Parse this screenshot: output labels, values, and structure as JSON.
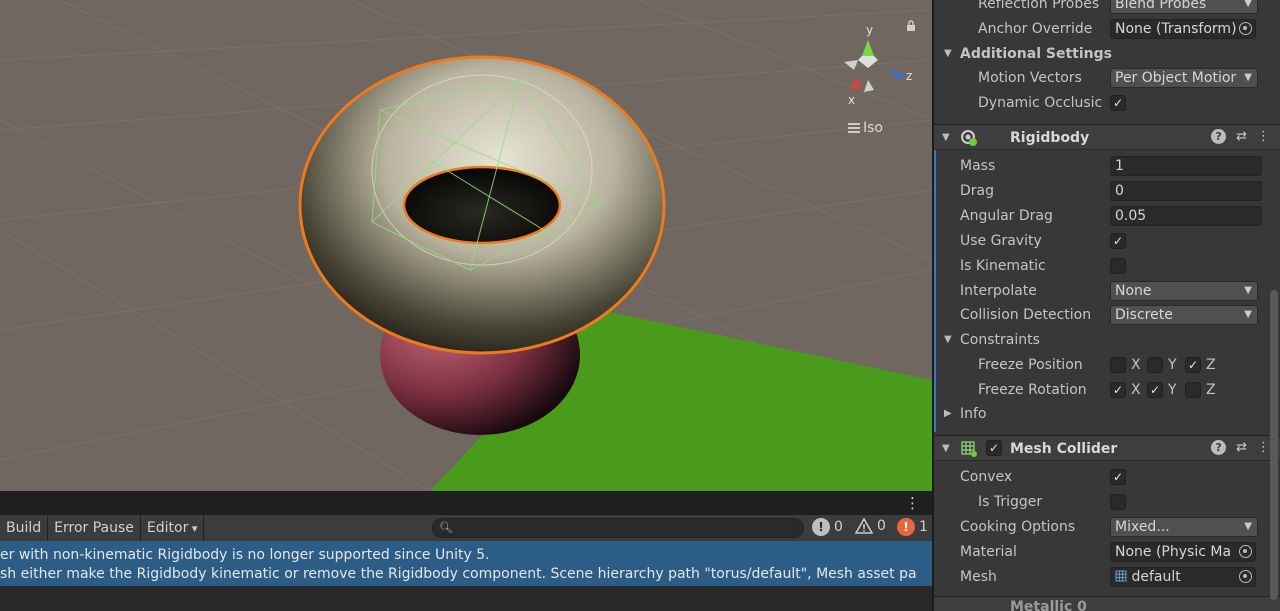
{
  "scene": {
    "gizmo": {
      "x_label": "x",
      "y_label": "y",
      "z_label": "z"
    },
    "projection_label": "Iso"
  },
  "console": {
    "toolbar": {
      "build_label": "Build",
      "error_pause_label": "Error Pause",
      "editor_label": "Editor",
      "search_placeholder": "",
      "info_count": "0",
      "warning_count": "0",
      "error_count": "1"
    },
    "message": {
      "line1": "er with non-kinematic Rigidbody is no longer supported since Unity 5.",
      "line2": "sh either make the Rigidbody kinematic or remove the Rigidbody component. Scene hierarchy path \"torus/default\", Mesh asset pa"
    },
    "colors": {
      "message_bg": "#2c5d87",
      "error_badge": "#e8663b"
    }
  },
  "inspector": {
    "renderer": {
      "reflection_probes_label": "Reflection Probes",
      "reflection_probes_value": "Blend Probes",
      "anchor_override_label": "Anchor Override",
      "anchor_override_value": "None (Transform)",
      "additional_settings_label": "Additional Settings",
      "motion_vectors_label": "Motion Vectors",
      "motion_vectors_value": "Per Object Motior",
      "dynamic_occlusion_label": "Dynamic Occlusic",
      "dynamic_occlusion_checked": true
    },
    "rigidbody": {
      "title": "Rigidbody",
      "mass_label": "Mass",
      "mass_value": "1",
      "drag_label": "Drag",
      "drag_value": "0",
      "angular_drag_label": "Angular Drag",
      "angular_drag_value": "0.05",
      "use_gravity_label": "Use Gravity",
      "use_gravity_checked": true,
      "is_kinematic_label": "Is Kinematic",
      "is_kinematic_checked": false,
      "interpolate_label": "Interpolate",
      "interpolate_value": "None",
      "collision_detection_label": "Collision Detection",
      "collision_detection_value": "Discrete",
      "constraints_label": "Constraints",
      "freeze_position_label": "Freeze Position",
      "freeze_position": {
        "x": false,
        "y": false,
        "z": true
      },
      "freeze_rotation_label": "Freeze Rotation",
      "freeze_rotation": {
        "x": true,
        "y": true,
        "z": false
      },
      "axis_x": "X",
      "axis_y": "Y",
      "axis_z": "Z",
      "info_label": "Info"
    },
    "mesh_collider": {
      "title": "Mesh Collider",
      "enabled": true,
      "convex_label": "Convex",
      "convex_checked": true,
      "is_trigger_label": "Is Trigger",
      "is_trigger_checked": false,
      "cooking_options_label": "Cooking Options",
      "cooking_options_value": "Mixed...",
      "material_label": "Material",
      "material_value": "None (Physic Ma",
      "mesh_label": "Mesh",
      "mesh_value": "default"
    },
    "next_component_title": "Metallic 0"
  }
}
